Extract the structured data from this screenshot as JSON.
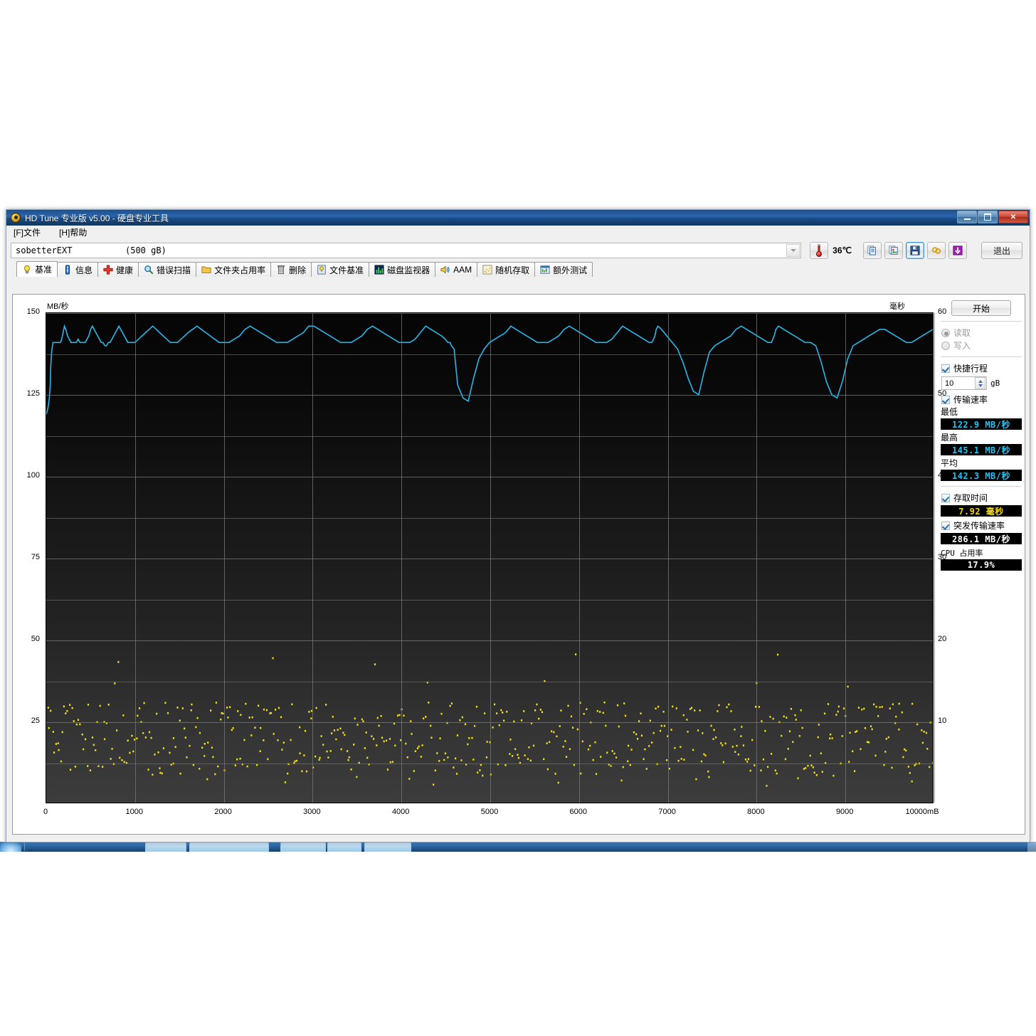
{
  "window": {
    "title": "HD Tune 专业版 v5.00 - 硬盘专业工具",
    "app_icon": "hdtune-icon",
    "minimize": "−",
    "maximize": "❐",
    "close": "✕"
  },
  "menubar": {
    "items": [
      {
        "accel": "[F]",
        "label": "文件"
      },
      {
        "accel": "[H]",
        "label": "帮助"
      }
    ]
  },
  "drivebar": {
    "drive_name": "sobetterEXT",
    "drive_capacity": "(500 gB)",
    "temperature": "36℃",
    "temp_icon": "thermometer-icon",
    "tools": [
      {
        "name": "copy-icon",
        "label": ""
      },
      {
        "name": "copy-image-icon",
        "label": ""
      },
      {
        "name": "save-icon",
        "label": "",
        "selected": true
      },
      {
        "name": "settings-icon",
        "label": ""
      },
      {
        "name": "download-icon",
        "label": ""
      }
    ],
    "exit_label": "退出"
  },
  "tabs": [
    {
      "label": "基准",
      "icon": "bulb-icon",
      "active": true
    },
    {
      "label": "信息",
      "icon": "info-icon",
      "active": false
    },
    {
      "label": "健康",
      "icon": "health-cross-icon",
      "active": false
    },
    {
      "label": "错误扫描",
      "icon": "magnifier-icon",
      "active": false
    },
    {
      "label": "文件夹占用率",
      "icon": "folder-icon",
      "active": false
    },
    {
      "label": "删除",
      "icon": "trash-icon",
      "active": false
    },
    {
      "label": "文件基准",
      "icon": "file-benchmark-icon",
      "active": false
    },
    {
      "label": "磁盘监视器",
      "icon": "bar-chart-icon",
      "active": false
    },
    {
      "label": "AAM",
      "icon": "speaker-icon",
      "active": false
    },
    {
      "label": "随机存取",
      "icon": "scatter-icon",
      "active": false
    },
    {
      "label": "额外测试",
      "icon": "extra-test-icon",
      "active": false
    }
  ],
  "sidebar": {
    "start_label": "开始",
    "mode_read": "读取",
    "mode_write": "写入",
    "mode_selected": "读取",
    "quick_scan_label": "快捷行程",
    "quick_scan_checked": true,
    "quick_scan_value": "10",
    "quick_scan_unit": "gB",
    "transfer_rate_label": "传输速率",
    "transfer_rate_checked": true,
    "min_label": "最低",
    "min_value": "122.9 MB/秒",
    "max_label": "最高",
    "max_value": "145.1 MB/秒",
    "avg_label": "平均",
    "avg_value": "142.3 MB/秒",
    "access_time_label": "存取时间",
    "access_time_checked": true,
    "access_time_value": "7.92 毫秒",
    "burst_rate_label": "突发传输速率",
    "burst_rate_checked": true,
    "burst_rate_value": "286.1 MB/秒",
    "cpu_label": "CPU 占用率",
    "cpu_value": "17.9%"
  },
  "chart_data": {
    "type": "line",
    "title": "",
    "xlabel": "",
    "x_unit_label": "10000mB",
    "ylabel": "MB/秒",
    "y2label": "毫秒",
    "xlim": [
      0,
      10000
    ],
    "xticks": [
      0,
      1000,
      2000,
      3000,
      4000,
      5000,
      6000,
      7000,
      8000,
      9000,
      10000
    ],
    "xticklabels": [
      "0",
      "1000",
      "2000",
      "3000",
      "4000",
      "5000",
      "6000",
      "7000",
      "8000",
      "9000",
      "10000mB"
    ],
    "ylim": [
      0,
      150
    ],
    "yticks": [
      25,
      50,
      75,
      100,
      125,
      150
    ],
    "yticklabels": [
      "25",
      "50",
      "75",
      "100",
      "125",
      "150"
    ],
    "y2lim": [
      0,
      60
    ],
    "y2ticks": [
      10,
      20,
      30,
      40,
      50,
      60
    ],
    "y2ticklabels": [
      "10",
      "20",
      "30",
      "40",
      "50",
      "60"
    ],
    "grid": true,
    "colors": {
      "transfer_line": "#29b6e8",
      "access_points": "#f2e014",
      "grid": "#7a7a7a",
      "background": "#0a0a0a"
    },
    "series": [
      {
        "name": "传输速率",
        "type": "line",
        "axis": "left",
        "color": "#29b6e8",
        "x": [
          0,
          20,
          35,
          45,
          50,
          60,
          75,
          90,
          105,
          120,
          140,
          160,
          175,
          190,
          205,
          220,
          240,
          260,
          280,
          300,
          320,
          340,
          360,
          380,
          400,
          420,
          440,
          460,
          480,
          500,
          520,
          540,
          560,
          580,
          600,
          620,
          640,
          660,
          680,
          700,
          720,
          740,
          760,
          780,
          800,
          820,
          840,
          860,
          880,
          900,
          920,
          940,
          960,
          980,
          1000,
          1040,
          1080,
          1120,
          1160,
          1200,
          1240,
          1280,
          1320,
          1360,
          1400,
          1440,
          1480,
          1520,
          1560,
          1600,
          1650,
          1700,
          1750,
          1800,
          1850,
          1900,
          1950,
          2000,
          2060,
          2120,
          2180,
          2240,
          2300,
          2360,
          2420,
          2480,
          2540,
          2600,
          2660,
          2720,
          2780,
          2840,
          2900,
          2960,
          3020,
          3080,
          3140,
          3200,
          3260,
          3320,
          3380,
          3440,
          3500,
          3560,
          3620,
          3680,
          3740,
          3800,
          3860,
          3920,
          3980,
          4040,
          4100,
          4160,
          4220,
          4280,
          4340,
          4400,
          4460,
          4500,
          4530,
          4545,
          4555,
          4570,
          4600,
          4640,
          4700,
          4760,
          4820,
          4880,
          4940,
          5000,
          5060,
          5120,
          5180,
          5240,
          5300,
          5360,
          5420,
          5480,
          5540,
          5600,
          5660,
          5720,
          5780,
          5840,
          5900,
          5960,
          6020,
          6080,
          6140,
          6200,
          6260,
          6320,
          6380,
          6440,
          6500,
          6560,
          6620,
          6680,
          6740,
          6800,
          6830,
          6850,
          6865,
          6880,
          6900,
          6940,
          7000,
          7060,
          7120,
          7180,
          7240,
          7300,
          7360,
          7420,
          7480,
          7540,
          7600,
          7660,
          7720,
          7780,
          7840,
          7900,
          7960,
          8020,
          8080,
          8140,
          8180,
          8195,
          8210,
          8230,
          8260,
          8320,
          8380,
          8440,
          8500,
          8560,
          8620,
          8680,
          8740,
          8800,
          8860,
          8920,
          8980,
          9040,
          9100,
          9160,
          9220,
          9280,
          9340,
          9400,
          9460,
          9520,
          9580,
          9640,
          9700,
          9760,
          9820,
          9880,
          9940,
          10000
        ],
        "y": [
          119,
          121,
          124,
          128,
          133,
          138,
          141,
          141,
          141,
          141,
          141,
          141,
          142,
          144,
          146,
          145,
          143,
          142,
          141,
          141,
          141,
          141,
          142,
          141,
          141,
          141,
          141,
          142,
          143,
          145,
          146,
          145,
          144,
          143,
          142,
          141,
          141,
          140,
          140,
          141,
          141,
          142,
          143,
          144,
          145,
          146,
          145,
          144,
          143,
          142,
          141,
          141,
          141,
          141,
          141,
          142,
          143,
          144,
          145,
          146,
          145,
          144,
          143,
          142,
          141,
          141,
          141,
          142,
          143,
          144,
          145,
          146,
          145,
          144,
          143,
          142,
          141,
          141,
          141,
          142,
          143,
          145,
          146,
          145,
          144,
          143,
          142,
          141,
          141,
          141,
          142,
          143,
          144,
          146,
          146,
          145,
          144,
          143,
          142,
          141,
          141,
          141,
          142,
          143,
          145,
          146,
          145,
          144,
          143,
          142,
          141,
          141,
          141,
          142,
          144,
          146,
          145,
          144,
          143,
          142,
          141,
          141,
          141,
          140,
          139,
          128,
          124,
          123,
          130,
          136,
          139,
          141,
          142,
          143,
          144,
          146,
          145,
          144,
          143,
          142,
          141,
          141,
          141,
          142,
          143,
          145,
          146,
          145,
          144,
          143,
          142,
          141,
          141,
          141,
          142,
          144,
          146,
          145,
          144,
          143,
          142,
          141,
          141,
          142,
          143,
          145,
          146,
          145,
          143,
          141,
          139,
          135,
          130,
          126,
          125,
          132,
          138,
          140,
          141,
          142,
          143,
          145,
          146,
          145,
          144,
          143,
          142,
          141,
          141,
          142,
          143,
          145,
          146,
          145,
          144,
          143,
          142,
          141,
          141,
          140,
          135,
          129,
          125,
          124,
          129,
          136,
          140,
          141,
          142,
          143,
          144,
          145,
          145,
          144,
          143,
          142,
          141,
          141,
          142,
          143,
          144,
          145,
          146,
          145,
          144,
          143,
          142,
          141,
          141,
          142,
          143,
          144,
          145,
          146,
          145,
          144,
          143,
          142,
          141,
          141,
          142,
          143,
          143
        ]
      },
      {
        "name": "存取时间",
        "type": "scatter",
        "axis": "right",
        "color": "#f2e014",
        "value_range_ms": [
          2,
          19
        ],
        "typical_ms": 7.92,
        "point_count": 540
      }
    ]
  }
}
